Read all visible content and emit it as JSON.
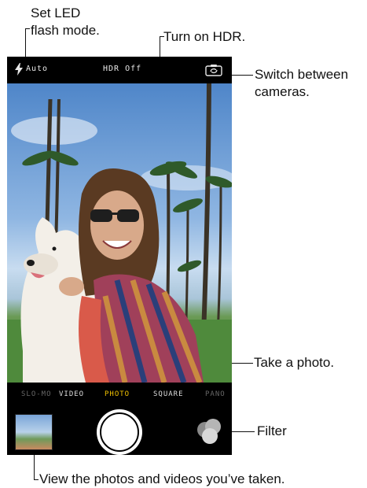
{
  "callouts": {
    "flash": "Set LED\nflash mode.",
    "hdr": "Turn on HDR.",
    "switch": "Switch between\ncameras.",
    "take_photo": "Take a photo.",
    "filter": "Filter",
    "view_photos": "View the photos and videos you’ve taken."
  },
  "camera": {
    "flash_mode": "Auto",
    "hdr_label": "HDR Off",
    "modes": [
      "SLO-MO",
      "VIDEO",
      "PHOTO",
      "SQUARE",
      "PANO"
    ],
    "active_mode": "PHOTO"
  },
  "colors": {
    "active_mode": "#f2c200",
    "bar_background": "#000000"
  },
  "icons": {
    "flash": "lightning-bolt-icon",
    "switch_camera": "camera-rotate-icon",
    "filter": "filter-circles-icon"
  }
}
